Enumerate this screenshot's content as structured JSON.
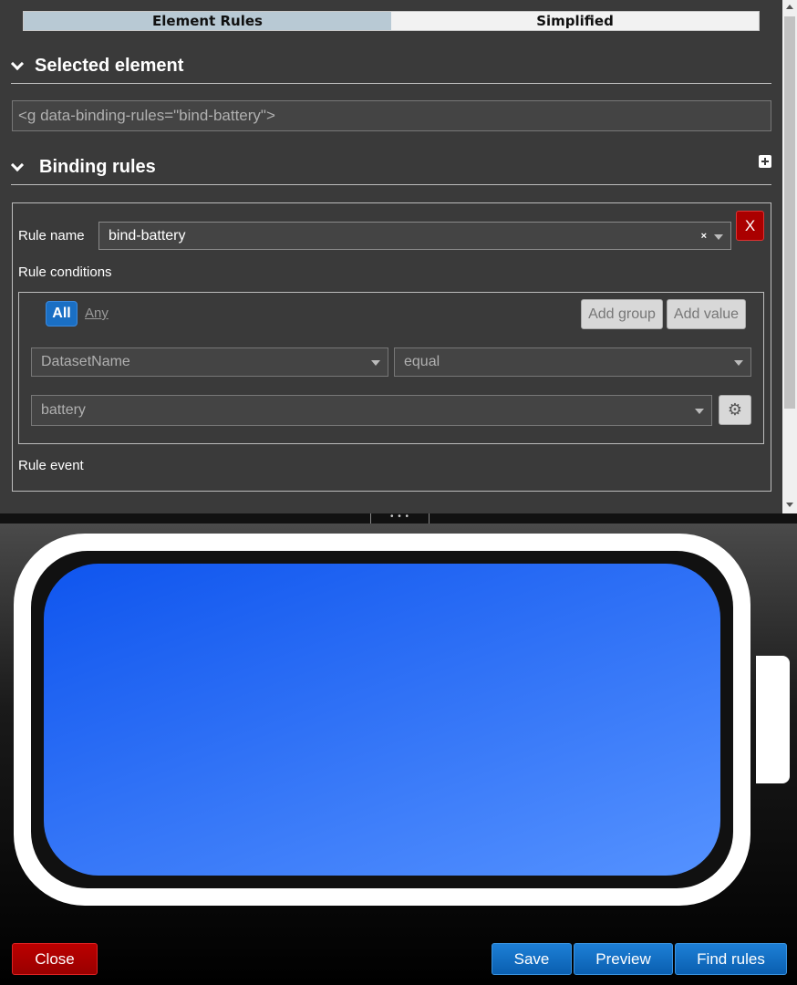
{
  "tabs": {
    "element_rules": "Element Rules",
    "simplified": "Simplified"
  },
  "selected_element": {
    "title": "Selected element",
    "value": "<g data-binding-rules=\"bind-battery\">"
  },
  "binding_rules": {
    "title": "Binding rules",
    "rule_name_label": "Rule name",
    "rule_name_value": "bind-battery",
    "clear_glyph": "×",
    "delete_label": "X",
    "rule_conditions_label": "Rule conditions",
    "all_label": "All",
    "any_label": "Any",
    "add_group_label": "Add group",
    "add_value_label": "Add value",
    "field_value": "DatasetName",
    "operator_value": "equal",
    "compare_value": "battery",
    "gear_glyph": "⚙",
    "rule_event_label": "Rule event"
  },
  "splitter": {
    "handle_glyph": "• • •"
  },
  "preview": {
    "fill_colors": [
      "#0f55ee",
      "#5592ff"
    ],
    "shell_color": "#ffffff"
  },
  "footer": {
    "close_label": "Close",
    "save_label": "Save",
    "preview_label": "Preview",
    "find_rules_label": "Find rules"
  },
  "colors": {
    "accent_blue": "#1a6fc4",
    "danger_red": "#aa0000",
    "panel_bg": "#3a3a3a"
  }
}
